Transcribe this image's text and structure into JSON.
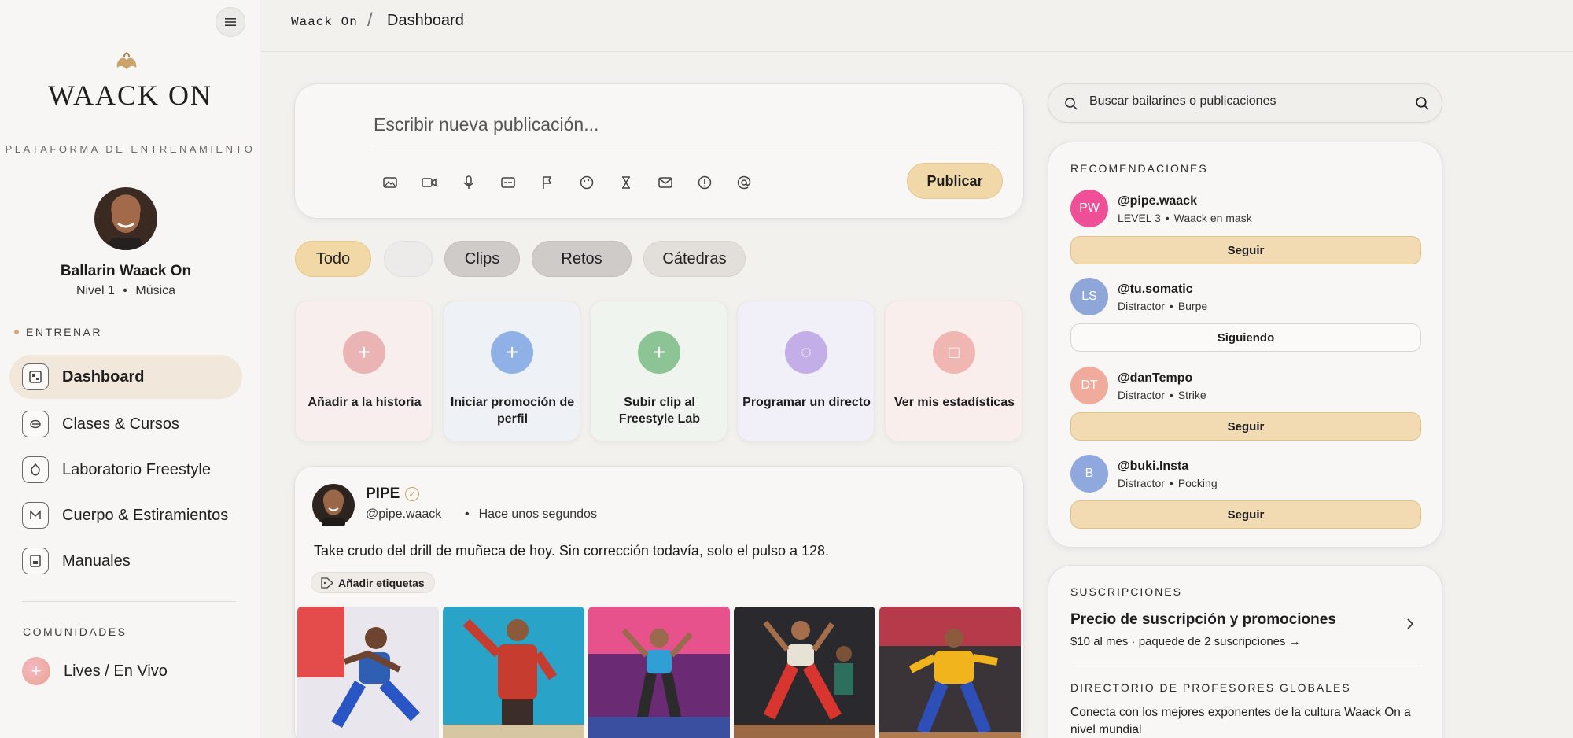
{
  "sidebar": {
    "logo_text": "WAACK ON",
    "platform_label": "PLATAFORMA DE ENTRENAMIENTO",
    "user": {
      "name": "Ballarin Waack On",
      "level": "Nivel 1",
      "category": "Música",
      "separator": "•"
    },
    "section_train": "ENTRENAR",
    "nav": [
      {
        "label": "Dashboard",
        "icon": "dashboard-icon",
        "active": true
      },
      {
        "label": "Clases & Cursos",
        "icon": "classes-icon",
        "active": false
      },
      {
        "label": "Laboratorio Freestyle",
        "icon": "lab-icon",
        "active": false
      },
      {
        "label": "Cuerpo & Estiramientos",
        "icon": "body-icon",
        "active": false
      },
      {
        "label": "Manuales",
        "icon": "manual-icon",
        "active": false
      }
    ],
    "section_communities": "COMUNIDADES",
    "live_label": "Lives / En Vivo"
  },
  "header": {
    "root": "Waack On",
    "separator": "/",
    "current": "Dashboard"
  },
  "composer": {
    "placeholder": "Escribir nueva publicación...",
    "tools": [
      "image-icon",
      "video-icon",
      "mic-icon",
      "caption-icon",
      "flag-icon",
      "palette-icon",
      "timer-icon",
      "mail-icon",
      "tip-icon",
      "mention-icon"
    ],
    "publish_label": "Publicar"
  },
  "filters": [
    {
      "label": "Todo",
      "state": "active"
    },
    {
      "label": "",
      "state": "blank"
    },
    {
      "label": "Clips",
      "state": "muted"
    },
    {
      "label": "Retos",
      "state": "muted"
    },
    {
      "label": "Cátedras",
      "state": "light"
    }
  ],
  "quick_actions": [
    {
      "label": "Añadir a la historia",
      "symbol": "+",
      "color": "#eab4b4",
      "bg": "#f9eeee"
    },
    {
      "label": "Iniciar promoción de perfil",
      "symbol": "+",
      "color": "#8fb1e6",
      "bg": "#eef2f7"
    },
    {
      "label": "Subir clip al Freestyle Lab",
      "symbol": "+",
      "color": "#8dc495",
      "bg": "#f0f4ef"
    },
    {
      "label": "Programar un directo",
      "symbol": "◌",
      "color": "#c4aee8",
      "bg": "#f1eff7"
    },
    {
      "label": "Ver mis estadísticas",
      "symbol": "□",
      "color": "#f0b6b2",
      "bg": "#faeeed"
    }
  ],
  "post": {
    "author": "PIPE",
    "handle": "@pipe.waack",
    "separator": "•",
    "time": "Hace unos segundos",
    "text": "Take crudo del drill de muñeca de hoy. Sin corrección todavía, solo el pulso a 128.",
    "tag_button": "Añadir etiquetas"
  },
  "search": {
    "placeholder": "Buscar bailarines o publicaciones"
  },
  "recommendations": {
    "title": "RECOMENDACIONES",
    "items": [
      {
        "initials": "PW",
        "handle": "@pipe.waack",
        "role": "LEVEL 3",
        "style": "Waack en mask",
        "button": "Seguir",
        "following": false,
        "color": "#ee4f96"
      },
      {
        "initials": "LS",
        "handle": "@tu.somatic",
        "role": "Distractor",
        "style": "Burpe",
        "button": "Siguiendo",
        "following": true,
        "color": "#8ea6d8"
      },
      {
        "initials": "DT",
        "handle": "@danTempo",
        "role": "Distractor",
        "style": "Strike",
        "button": "Seguir",
        "following": false,
        "color": "#f0ab9c"
      },
      {
        "initials": "B",
        "handle": "@buki.Insta",
        "role": "Distractor",
        "style": "Pocking",
        "button": "Seguir",
        "following": false,
        "color": "#8fa8de"
      }
    ],
    "separator": "•"
  },
  "subscriptions": {
    "title": "SUSCRIPCIONES",
    "heading": "Precio de suscripción y promociones",
    "meta": "$10 al mes · paquede de 2 suscripciones →",
    "directory_title": "DIRECTORIO DE PROFESORES GLOBALES",
    "directory_text": "Conecta con los mejores exponentes de la cultura Waack On a nivel mundial"
  },
  "colors": {
    "accent": "#f0d8a8",
    "active_nav": "#f1e7db",
    "background": "#f3f1ee"
  }
}
